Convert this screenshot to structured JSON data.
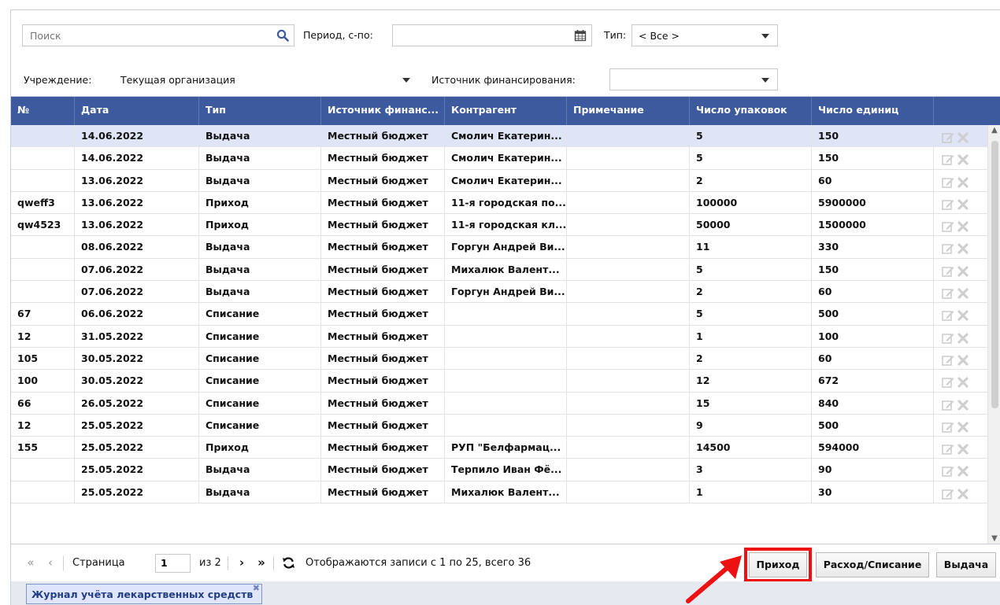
{
  "filters": {
    "search_placeholder": "Поиск",
    "period_label": "Период, с-по:",
    "period_value": "",
    "type_label": "Тип:",
    "type_value": "< Все >",
    "institution_label": "Учреждение:",
    "institution_value": "Текущая организация",
    "source_label": "Источник финансирования:",
    "source_value": ""
  },
  "table": {
    "columns": [
      "№",
      "Дата",
      "Тип",
      "Источник финанс...",
      "Контрагент",
      "Примечание",
      "Число упаковок",
      "Число единиц",
      ""
    ],
    "rows": [
      {
        "num": "",
        "date": "14.06.2022",
        "type": "Выдача",
        "source": "Местный бюджет",
        "partner": "Смолич Екатерин...",
        "note": "",
        "packs": "5",
        "units": "150"
      },
      {
        "num": "",
        "date": "14.06.2022",
        "type": "Выдача",
        "source": "Местный бюджет",
        "partner": "Смолич Екатерин...",
        "note": "",
        "packs": "5",
        "units": "150"
      },
      {
        "num": "",
        "date": "13.06.2022",
        "type": "Выдача",
        "source": "Местный бюджет",
        "partner": "Смолич Екатерин...",
        "note": "",
        "packs": "2",
        "units": "60"
      },
      {
        "num": "qweff3",
        "date": "13.06.2022",
        "type": "Приход",
        "source": "Местный бюджет",
        "partner": "11-я городская по...",
        "note": "",
        "packs": "100000",
        "units": "5900000"
      },
      {
        "num": "qw4523",
        "date": "13.06.2022",
        "type": "Приход",
        "source": "Местный бюджет",
        "partner": "11-я городская кл...",
        "note": "",
        "packs": "50000",
        "units": "1500000"
      },
      {
        "num": "",
        "date": "08.06.2022",
        "type": "Выдача",
        "source": "Местный бюджет",
        "partner": "Горгун Андрей Ви...",
        "note": "",
        "packs": "11",
        "units": "330"
      },
      {
        "num": "",
        "date": "07.06.2022",
        "type": "Выдача",
        "source": "Местный бюджет",
        "partner": "Михалюк Валент...",
        "note": "",
        "packs": "5",
        "units": "150"
      },
      {
        "num": "",
        "date": "07.06.2022",
        "type": "Выдача",
        "source": "Местный бюджет",
        "partner": "Горгун Андрей Ви...",
        "note": "",
        "packs": "2",
        "units": "60"
      },
      {
        "num": "67",
        "date": "06.06.2022",
        "type": "Списание",
        "source": "Местный бюджет",
        "partner": "",
        "note": "",
        "packs": "5",
        "units": "500"
      },
      {
        "num": "12",
        "date": "31.05.2022",
        "type": "Списание",
        "source": "Местный бюджет",
        "partner": "",
        "note": "",
        "packs": "1",
        "units": "100"
      },
      {
        "num": "105",
        "date": "30.05.2022",
        "type": "Списание",
        "source": "Местный бюджет",
        "partner": "",
        "note": "",
        "packs": "2",
        "units": "60"
      },
      {
        "num": "100",
        "date": "30.05.2022",
        "type": "Списание",
        "source": "Местный бюджет",
        "partner": "",
        "note": "",
        "packs": "12",
        "units": "672"
      },
      {
        "num": "66",
        "date": "26.05.2022",
        "type": "Списание",
        "source": "Местный бюджет",
        "partner": "",
        "note": "",
        "packs": "15",
        "units": "840"
      },
      {
        "num": "12",
        "date": "25.05.2022",
        "type": "Списание",
        "source": "Местный бюджет",
        "partner": "",
        "note": "",
        "packs": "9",
        "units": "500"
      },
      {
        "num": "155",
        "date": "25.05.2022",
        "type": "Приход",
        "source": "Местный бюджет",
        "partner": "РУП \"Белфармац...",
        "note": "",
        "packs": "14500",
        "units": "594000"
      },
      {
        "num": "",
        "date": "25.05.2022",
        "type": "Выдача",
        "source": "Местный бюджет",
        "partner": "Терпило Иван Фё...",
        "note": "",
        "packs": "3",
        "units": "90"
      },
      {
        "num": "",
        "date": "25.05.2022",
        "type": "Выдача",
        "source": "Местный бюджет",
        "partner": "Михалюк Валент...",
        "note": "",
        "packs": "1",
        "units": "30"
      }
    ]
  },
  "pager": {
    "page_label": "Страница",
    "page_value": "1",
    "of_label": "из 2",
    "status": "Отображаются записи с 1 по 25, всего 36"
  },
  "actions": {
    "income": "Приход",
    "writeoff": "Расход/Списание",
    "issue": "Выдача"
  },
  "tabs": [
    {
      "label": "Журнал учёта лекарственных средств"
    }
  ],
  "colors": {
    "header_bg": "#3d5a9e",
    "selected_row": "#dfe4f7",
    "highlight": "#ee1111"
  }
}
